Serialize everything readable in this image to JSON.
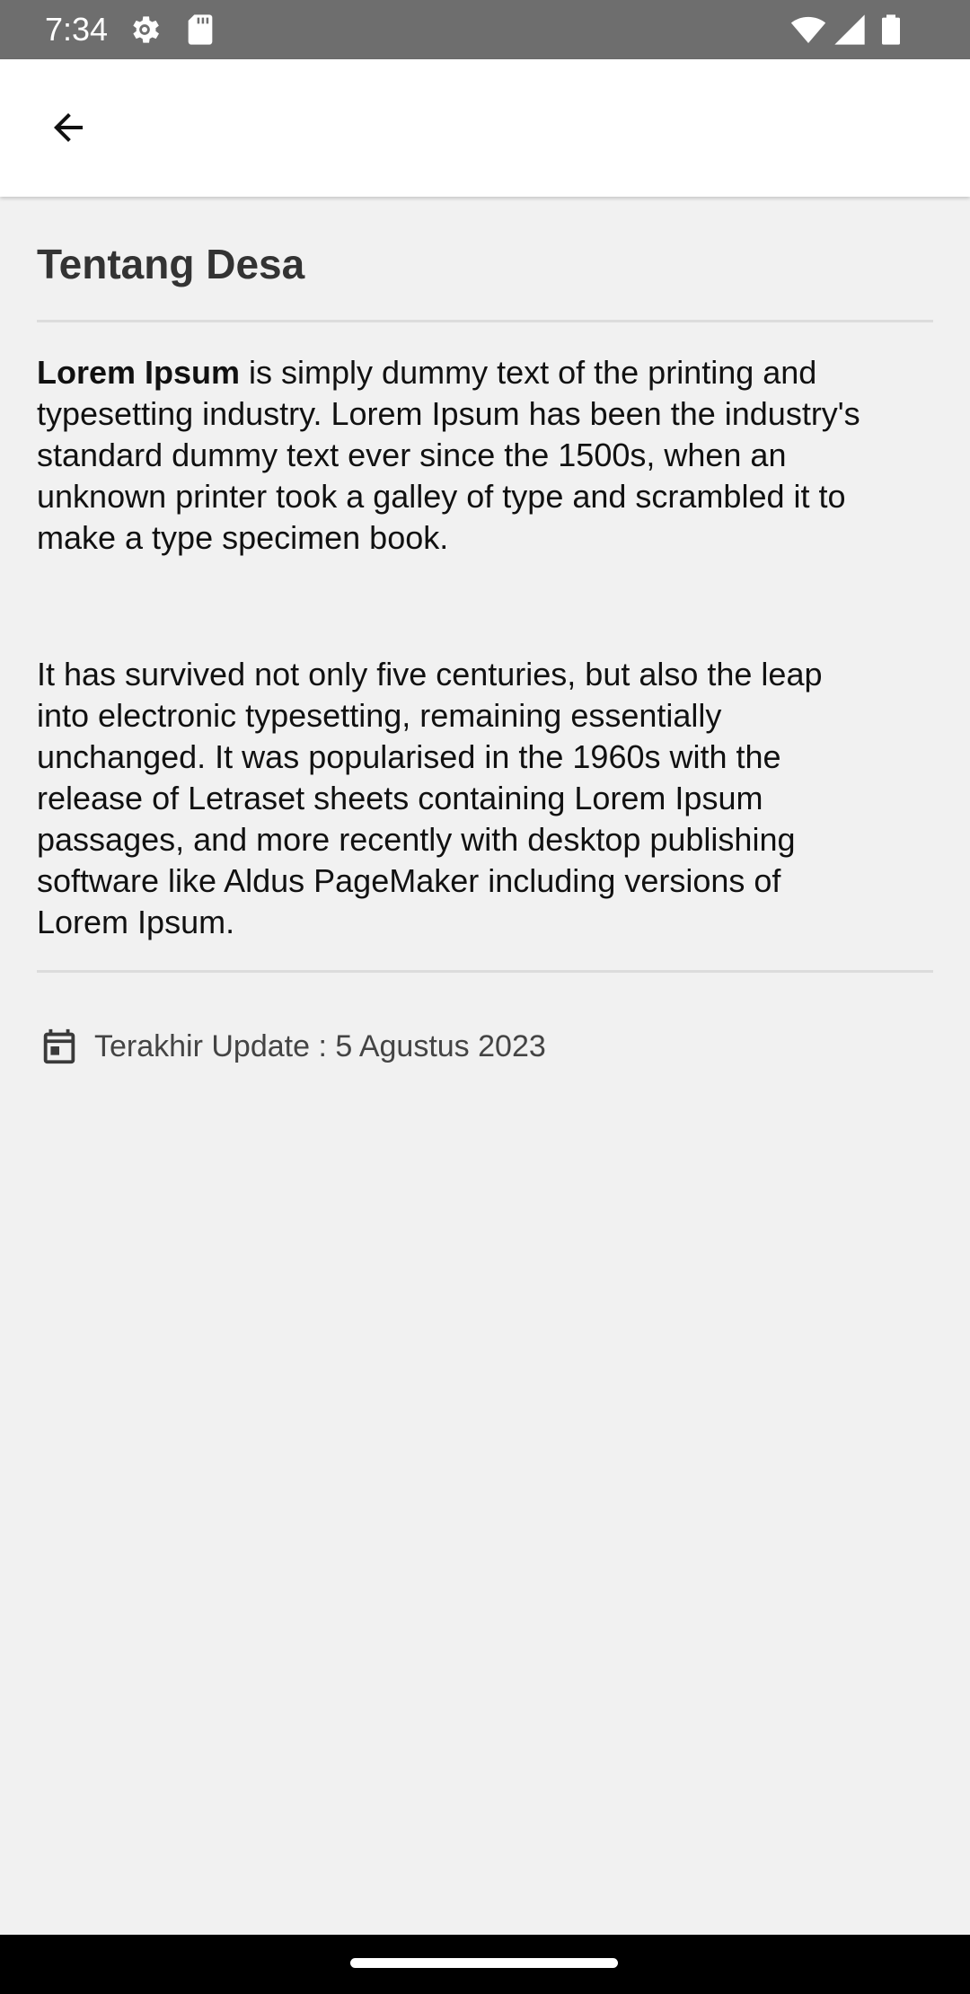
{
  "status_bar": {
    "time": "7:34",
    "icons": [
      "settings-gear-icon",
      "sd-card-icon",
      "wifi-icon",
      "cell-signal-icon",
      "battery-icon"
    ]
  },
  "app_bar": {
    "back_icon": "arrow-left-icon"
  },
  "page": {
    "title": "Tentang Desa",
    "paragraph1_bold": "Lorem Ipsum",
    "paragraph1_rest": " is simply dummy text of the printing and typesetting industry. Lorem Ipsum has been the industry's standard dummy text ever since the 1500s, when an unknown printer took a galley of type and scrambled it to make a type specimen book.",
    "paragraph2": "It has survived not only five centuries, but also the leap into electronic typesetting, remaining essentially unchanged. It was popularised in the 1960s with the release of Letraset sheets containing Lorem Ipsum passages, and more recently with desktop publishing software like Aldus PageMaker including versions of Lorem Ipsum.",
    "update_icon": "calendar-icon",
    "update_text": "Terakhir Update : 5 Agustus 2023"
  },
  "colors": {
    "status_bar_bg": "#6e6e6e",
    "app_bar_bg": "#ffffff",
    "page_bg": "#f1f1f1",
    "nav_bar_bg": "#000000"
  }
}
